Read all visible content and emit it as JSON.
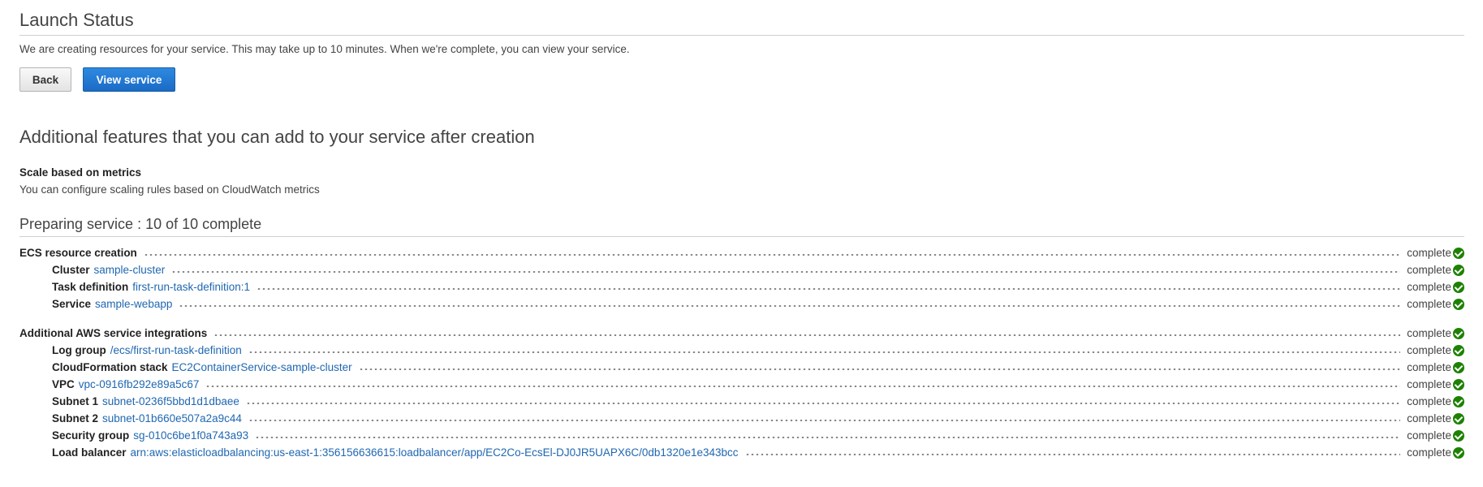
{
  "launch": {
    "title": "Launch Status",
    "message": "We are creating resources for your service. This may take up to 10 minutes. When we're complete, you can view your service.",
    "back_label": "Back",
    "view_label": "View service"
  },
  "features": {
    "title": "Additional features that you can add to your service after creation",
    "scale_title": "Scale based on metrics",
    "scale_desc": "You can configure scaling rules based on CloudWatch metrics"
  },
  "progress": {
    "title": "Preparing service : 10 of 10 complete",
    "status_color": "#1d8102",
    "rows": [
      {
        "label": "ECS resource creation",
        "value": "",
        "status": "complete"
      },
      {
        "label": "Cluster",
        "value": "sample-cluster",
        "status": "complete"
      },
      {
        "label": "Task definition",
        "value": "first-run-task-definition:1",
        "status": "complete"
      },
      {
        "label": "Service",
        "value": "sample-webapp",
        "status": "complete"
      },
      {
        "label": "Additional AWS service integrations",
        "value": "",
        "status": "complete"
      },
      {
        "label": "Log group",
        "value": "/ecs/first-run-task-definition",
        "status": "complete"
      },
      {
        "label": "CloudFormation stack",
        "value": "EC2ContainerService-sample-cluster",
        "status": "complete"
      },
      {
        "label": "VPC",
        "value": "vpc-0916fb292e89a5c67",
        "status": "complete"
      },
      {
        "label": "Subnet 1",
        "value": "subnet-0236f5bbd1d1dbaee",
        "status": "complete"
      },
      {
        "label": "Subnet 2",
        "value": "subnet-01b660e507a2a9c44",
        "status": "complete"
      },
      {
        "label": "Security group",
        "value": "sg-010c6be1f0a743a93",
        "status": "complete"
      },
      {
        "label": "Load balancer",
        "value": "arn:aws:elasticloadbalancing:us-east-1:356156636615:loadbalancer/app/EC2Co-EcsEl-DJ0JR5UAPX6C/0db1320e1e343bcc",
        "status": "complete"
      }
    ]
  }
}
